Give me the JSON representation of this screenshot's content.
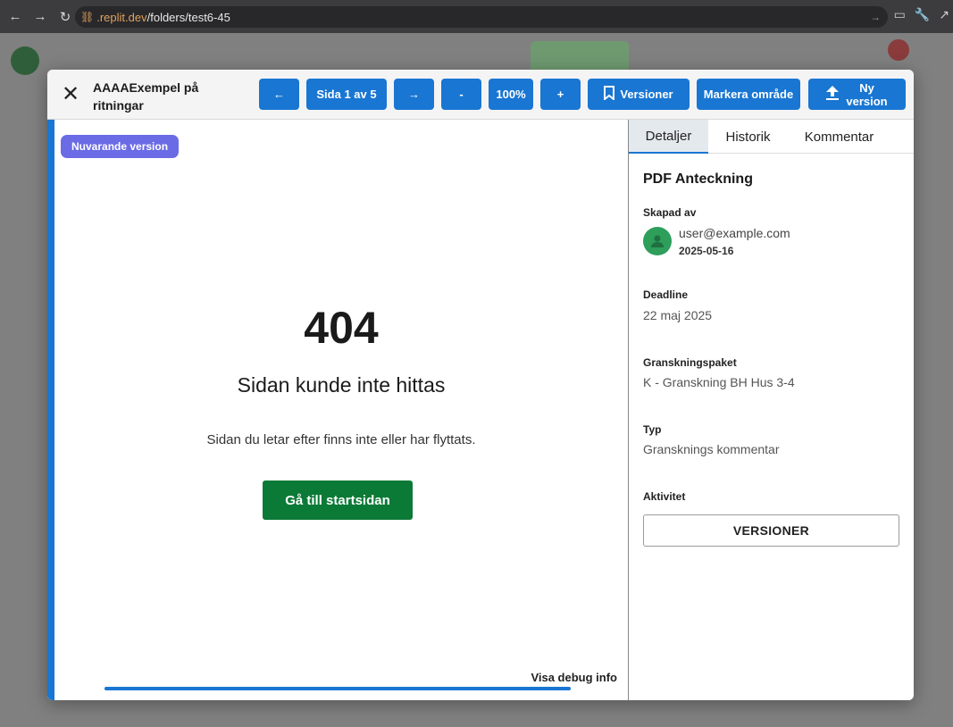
{
  "browser": {
    "url_host": ".replit.dev",
    "url_path": "/folders/test6-45"
  },
  "modal": {
    "title": "AAAAExempel på ritningar",
    "toolbar": {
      "prev_label": "←",
      "page_label": "Sida 1 av 5",
      "next_label": "→",
      "zoom_out_label": "-",
      "zoom_level": "100%",
      "zoom_in_label": "+",
      "versions_label": "Versioner",
      "mark_area_label": "Markera område",
      "new_version_label": "Ny version"
    },
    "viewer": {
      "version_badge": "Nuvarande version",
      "error_code": "404",
      "error_title": "Sidan kunde inte hittas",
      "error_description": "Sidan du letar efter finns inte eller har flyttats.",
      "home_button": "Gå till startsidan",
      "debug_link": "Visa debug info",
      "progress": 1.0
    },
    "sidebar": {
      "tabs": [
        {
          "label": "Detaljer",
          "active": true
        },
        {
          "label": "Historik",
          "active": false
        },
        {
          "label": "Kommentar",
          "active": false
        }
      ],
      "section_title": "PDF Anteckning",
      "created_by_label": "Skapad av",
      "user_email": "user@example.com",
      "created_date": "2025-05-16",
      "deadline_label": "Deadline",
      "deadline_value": "22 maj 2025",
      "package_label": "Granskningspaket",
      "package_value": "K - Granskning BH Hus 3-4",
      "type_label": "Typ",
      "type_value": "Gransknings kommentar",
      "activity_label": "Aktivitet",
      "versions_button": "VERSIONER"
    }
  },
  "colors": {
    "primary": "#1976d2",
    "badge": "#6b6be6",
    "home_button": "#0b7a36",
    "avatar": "#2e9e5b"
  }
}
